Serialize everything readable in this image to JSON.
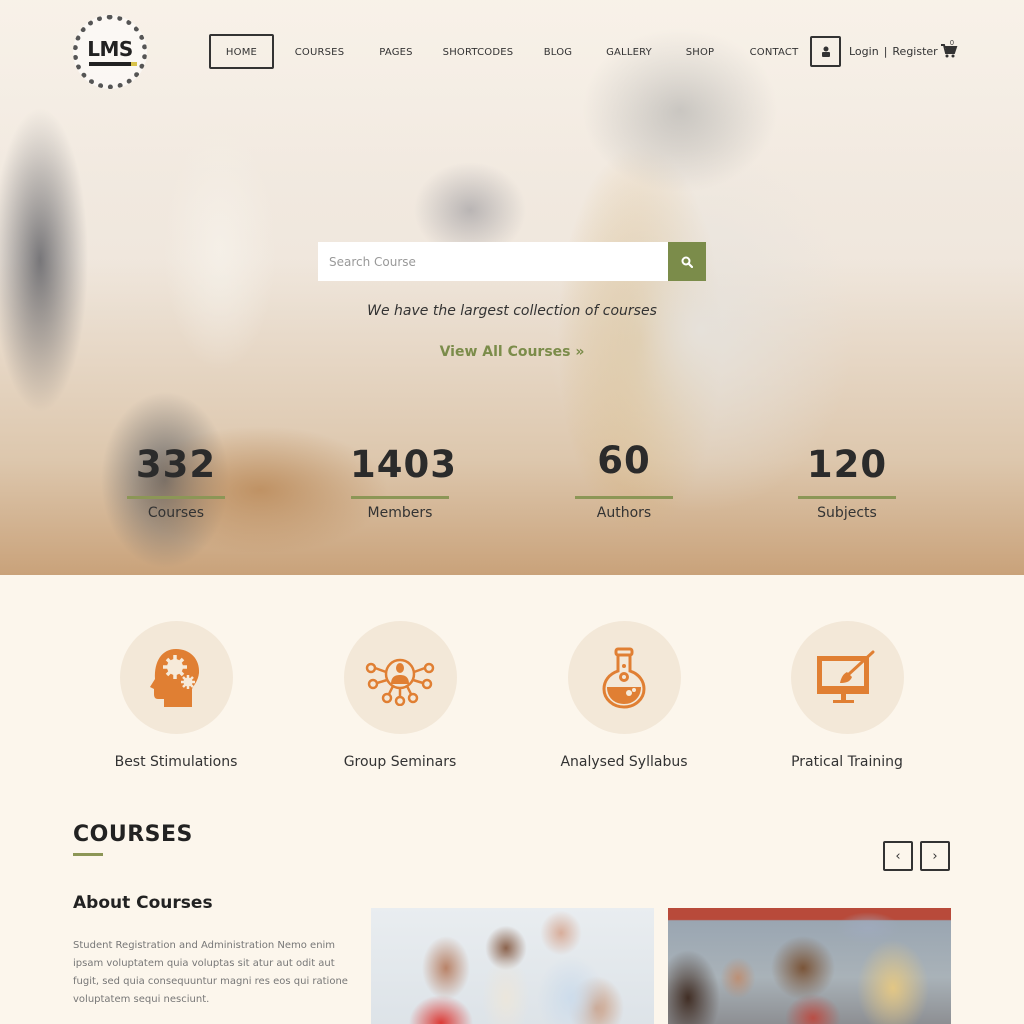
{
  "header": {
    "logo_text": "LMS",
    "nav": [
      {
        "label": "HOME",
        "active": true
      },
      {
        "label": "COURSES",
        "active": false
      },
      {
        "label": "PAGES",
        "active": false
      },
      {
        "label": "SHORTCODES",
        "active": false
      },
      {
        "label": "BLOG",
        "active": false
      },
      {
        "label": "GALLERY",
        "active": false
      },
      {
        "label": "SHOP",
        "active": false
      },
      {
        "label": "CONTACT",
        "active": false
      }
    ],
    "user_icon": "user-icon",
    "login_label": "Login",
    "separator": "|",
    "register_label": "Register",
    "cart_icon": "cart-icon",
    "cart_count": "0"
  },
  "hero": {
    "search": {
      "placeholder": "Search Course",
      "value": "",
      "button_icon": "search-icon"
    },
    "tagline": "We have the largest collection of courses",
    "view_all_label": "View All Courses »",
    "stats": [
      {
        "value": "332",
        "label": "Courses"
      },
      {
        "value": "1403",
        "label": "Members"
      },
      {
        "value": "60",
        "label": "Authors"
      },
      {
        "value": "120",
        "label": "Subjects"
      }
    ]
  },
  "features": [
    {
      "icon": "head-gears-icon",
      "label": "Best Stimulations"
    },
    {
      "icon": "network-person-icon",
      "label": "Group Seminars"
    },
    {
      "icon": "flask-icon",
      "label": "Analysed Syllabus"
    },
    {
      "icon": "monitor-brush-icon",
      "label": "Pratical Training"
    }
  ],
  "courses": {
    "title": "COURSES",
    "prev_label": "‹",
    "next_label": "›",
    "about_title": "About Courses",
    "about_text": "Student Registration and Administration Nemo enim ipsam voluptatem quia voluptas sit atur aut odit aut fugit, sed quia consequuntur magni res eos qui ratione voluptatem sequi nesciunt."
  },
  "colors": {
    "accent": "#7b8c4a",
    "icon_orange": "#e07f33",
    "background": "#fcf6ec",
    "feature_circle": "#f3e8d8"
  }
}
